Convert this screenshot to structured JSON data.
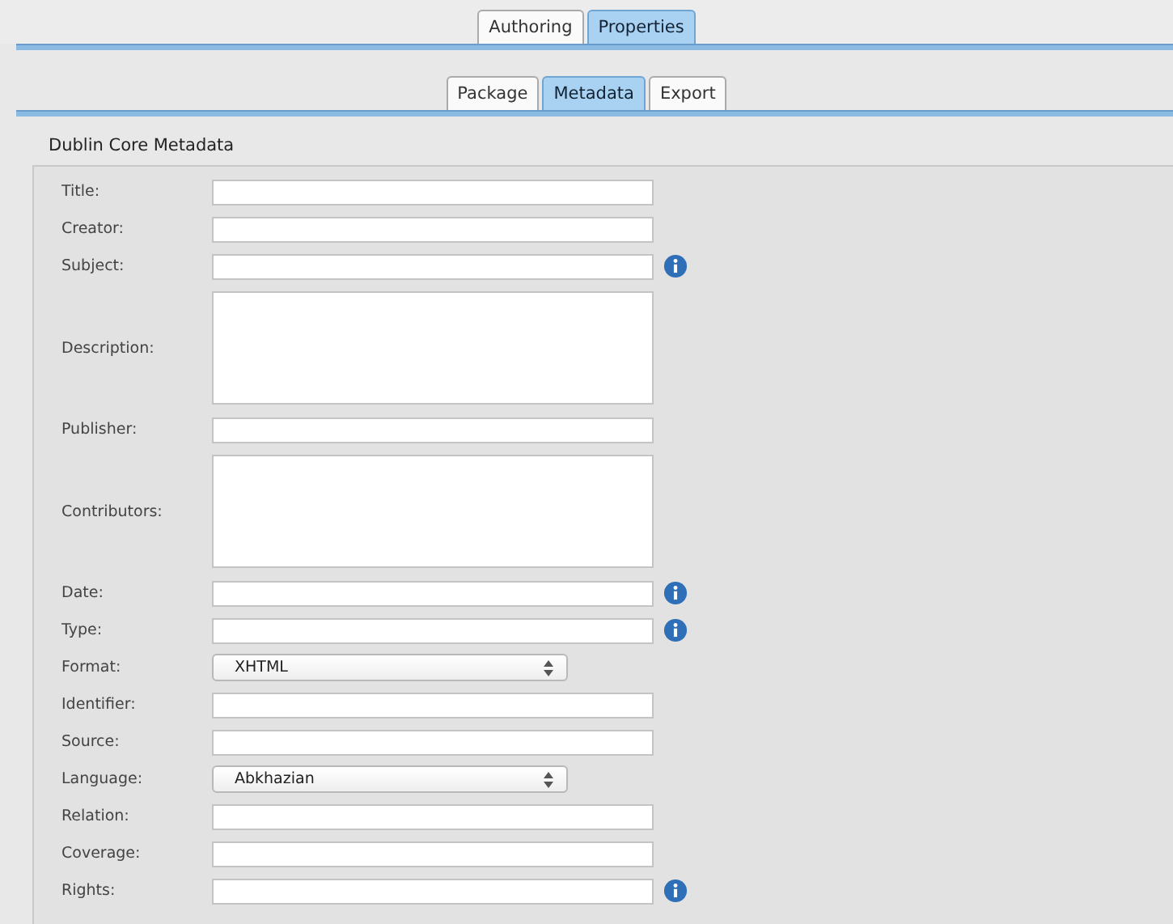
{
  "main_tabs": [
    {
      "label": "Authoring",
      "selected": false
    },
    {
      "label": "Properties",
      "selected": true
    }
  ],
  "sub_tabs": [
    {
      "label": "Package",
      "selected": false
    },
    {
      "label": "Metadata",
      "selected": true
    },
    {
      "label": "Export",
      "selected": false
    }
  ],
  "section_title": "Dublin Core Metadata",
  "fields": [
    {
      "label": "Title:",
      "kind": "text",
      "info": false
    },
    {
      "label": "Creator:",
      "kind": "text",
      "info": false
    },
    {
      "label": "Subject:",
      "kind": "text",
      "info": true
    },
    {
      "label": "Description:",
      "kind": "textarea",
      "info": false
    },
    {
      "label": "Publisher:",
      "kind": "text",
      "info": false
    },
    {
      "label": "Contributors:",
      "kind": "textarea",
      "info": false
    },
    {
      "label": "Date:",
      "kind": "text",
      "info": true
    },
    {
      "label": "Type:",
      "kind": "text",
      "info": true
    },
    {
      "label": "Format:",
      "kind": "select",
      "value": "XHTML",
      "info": false
    },
    {
      "label": "Identifier:",
      "kind": "text",
      "info": false
    },
    {
      "label": "Source:",
      "kind": "text",
      "info": false
    },
    {
      "label": "Language:",
      "kind": "select",
      "value": "Abkhazian",
      "info": false
    },
    {
      "label": "Relation:",
      "kind": "text",
      "info": false
    },
    {
      "label": "Coverage:",
      "kind": "text",
      "info": false
    },
    {
      "label": "Rights:",
      "kind": "text",
      "info": true
    }
  ]
}
